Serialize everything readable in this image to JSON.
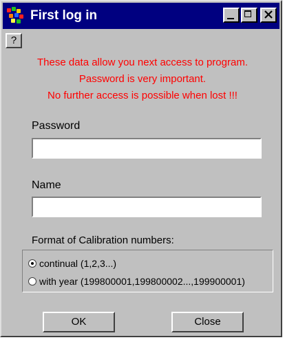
{
  "window": {
    "title": "First log in",
    "title_bar_color": "#000080",
    "background_color": "#c0c0c0"
  },
  "title_buttons": {
    "minimize_icon": "minimize-icon",
    "maximize_icon": "maximize-icon",
    "close_icon": "close-icon"
  },
  "help_button": {
    "label": "?"
  },
  "messages": {
    "color": "#ff0000",
    "lines": [
      "These data allow you next access to program.",
      "Password is very important.",
      "No further access is possible when lost !!!"
    ]
  },
  "password": {
    "label": "Password",
    "value": ""
  },
  "name": {
    "label": "Name",
    "value": ""
  },
  "format": {
    "label": "Format of Calibration numbers:",
    "options": [
      {
        "label": "continual (1,2,3...)",
        "selected": true
      },
      {
        "label": "with year (199800001,199800002...,199900001)",
        "selected": false
      }
    ]
  },
  "buttons": {
    "ok": "OK",
    "close": "Close"
  }
}
